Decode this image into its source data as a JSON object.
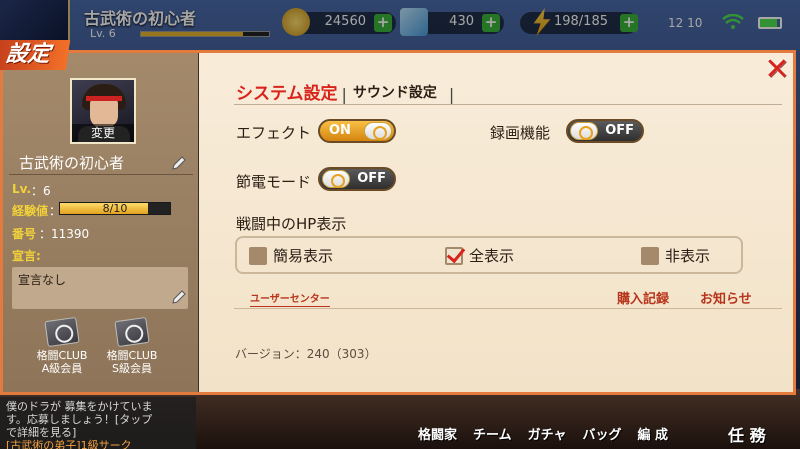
{
  "hud": {
    "player_name": "古武術の初心者",
    "level": "Lv. 6",
    "gold": "24560",
    "gems": "430",
    "stamina": "198/185",
    "time": "12 10"
  },
  "dialog": {
    "title": "設定",
    "close_symbol": "✕"
  },
  "profile": {
    "change_label": "変更",
    "name": "古武術の初心者",
    "level_label": "Lv.",
    "level_value": "：6",
    "exp_label": "経験値",
    "exp_value": "8/10",
    "exp_fraction": 0.8,
    "number_label": "番号",
    "number_value": "：11390",
    "declaration_label": "宣言:",
    "declaration_text": "宣言なし",
    "clubs": [
      {
        "line1": "格闘CLUB",
        "line2": "A級会員"
      },
      {
        "line1": "格闘CLUB",
        "line2": "S級会員"
      }
    ]
  },
  "tabs": {
    "system": "システム設定",
    "sound": "サウンド設定",
    "separator": "|"
  },
  "settings": {
    "effect_label": "エフェクト",
    "effect_state": "ON",
    "record_label": "録画機能",
    "record_state": "OFF",
    "power_label": "節電モード",
    "power_state": "OFF",
    "hp_label": "戦闘中のHP表示",
    "hp_options": [
      "簡易表示",
      "全表示",
      "非表示"
    ],
    "hp_selected": "全表示"
  },
  "links": {
    "user_center": "ユーザーセンター",
    "purchase": "購入記録",
    "news": "お知らせ"
  },
  "version": "バージョン：240（303）",
  "chat": {
    "lines": [
      "僕のドラが 募集をかけていま",
      "す。応募しましょう！[タップ",
      "で詳細を見る]"
    ],
    "footer": "[古武術の弟子]1級サーク"
  },
  "menu": [
    "格闘家",
    "チーム",
    "ガチャ",
    "バッグ",
    "編 成"
  ],
  "task": "任 務",
  "colors": {
    "accent": "#e27b3d",
    "active_tab": "#d8241c",
    "toggle_on": "#f0a820",
    "toggle_off": "#3a3a3a"
  }
}
